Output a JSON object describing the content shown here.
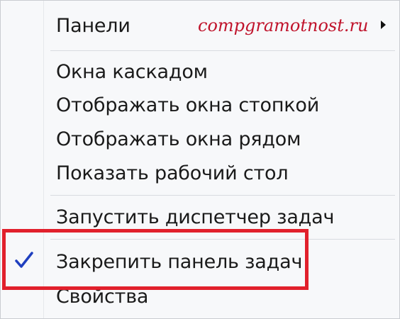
{
  "menu": {
    "items": [
      {
        "label": "Панели",
        "has_submenu": true
      },
      {
        "label": "Окна каскадом"
      },
      {
        "label": "Отображать окна стопкой"
      },
      {
        "label": "Отображать окна рядом"
      },
      {
        "label": "Показать рабочий стол"
      },
      {
        "label": "Запустить диспетчер задач"
      },
      {
        "label": "Закрепить панель задач",
        "checked": true
      },
      {
        "label": "Свойства"
      }
    ]
  },
  "watermark": "compgramotnost.ru",
  "colors": {
    "highlight": "#e1202c",
    "watermark": "#c0142c",
    "check": "#1f3fbf"
  },
  "icons": {
    "submenu": "chevron-right-icon",
    "checked": "checkmark-icon"
  }
}
